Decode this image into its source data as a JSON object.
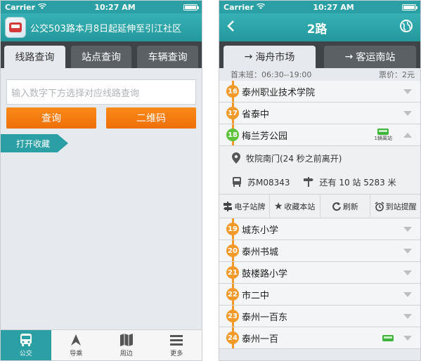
{
  "left": {
    "status": {
      "carrier": "Carrier",
      "time": "10:27 AM"
    },
    "header": {
      "marquee": "公交503路本月8日起延伸至引江社区"
    },
    "tabs": [
      {
        "label": "线路查询",
        "active": true
      },
      {
        "label": "站点查询",
        "active": false
      },
      {
        "label": "车辆查询",
        "active": false
      }
    ],
    "search": {
      "placeholder": "输入数字下方选择对应线路查询"
    },
    "buttons": {
      "query": "查询",
      "qrcode": "二维码"
    },
    "favorites_label": "打开收藏",
    "tabbar": [
      {
        "label": "公交",
        "icon": "bus-icon",
        "active": true
      },
      {
        "label": "导乘",
        "icon": "navigation-icon",
        "active": false
      },
      {
        "label": "周边",
        "icon": "map-icon",
        "active": false
      },
      {
        "label": "更多",
        "icon": "menu-icon",
        "active": false
      }
    ]
  },
  "right": {
    "status": {
      "carrier": "Carrier",
      "time": "10:27 AM"
    },
    "header": {
      "title": "2路"
    },
    "tabs": [
      {
        "label": "海舟市场",
        "active": true
      },
      {
        "label": "客运南站",
        "active": false
      }
    ],
    "info": {
      "hours": "首末班：06:30--19:00",
      "fare": "票价：2元"
    },
    "stops_before": [
      {
        "num": "16",
        "name": "泰州职业技术学院"
      },
      {
        "num": "17",
        "name": "省泰中"
      },
      {
        "num": "18",
        "name": "梅兰芳公园",
        "bus_label": "1辆离站",
        "expanded": true
      }
    ],
    "detail": {
      "location": "牧院南门(24 秒之前离开)",
      "plate": "苏M08343",
      "remaining": "还有 10 站 5283 米"
    },
    "actions": [
      {
        "label": "电子站牌",
        "icon": "signpost-icon"
      },
      {
        "label": "收藏本站",
        "icon": "star-icon"
      },
      {
        "label": "刷新",
        "icon": "refresh-icon"
      },
      {
        "label": "到站提醒",
        "icon": "alarm-icon"
      }
    ],
    "stops_after": [
      {
        "num": "19",
        "name": "城东小学"
      },
      {
        "num": "20",
        "name": "泰州书城"
      },
      {
        "num": "21",
        "name": "鼓楼路小学"
      },
      {
        "num": "22",
        "name": "市二中"
      },
      {
        "num": "23",
        "name": "泰州一百东"
      },
      {
        "num": "24",
        "name": "泰州一百",
        "has_bus": true
      }
    ]
  },
  "colors": {
    "accent": "#2a9fa4",
    "orange": "#f39a2a",
    "dark_tabs": "#3f4448",
    "bus_green": "#3fb43a"
  }
}
